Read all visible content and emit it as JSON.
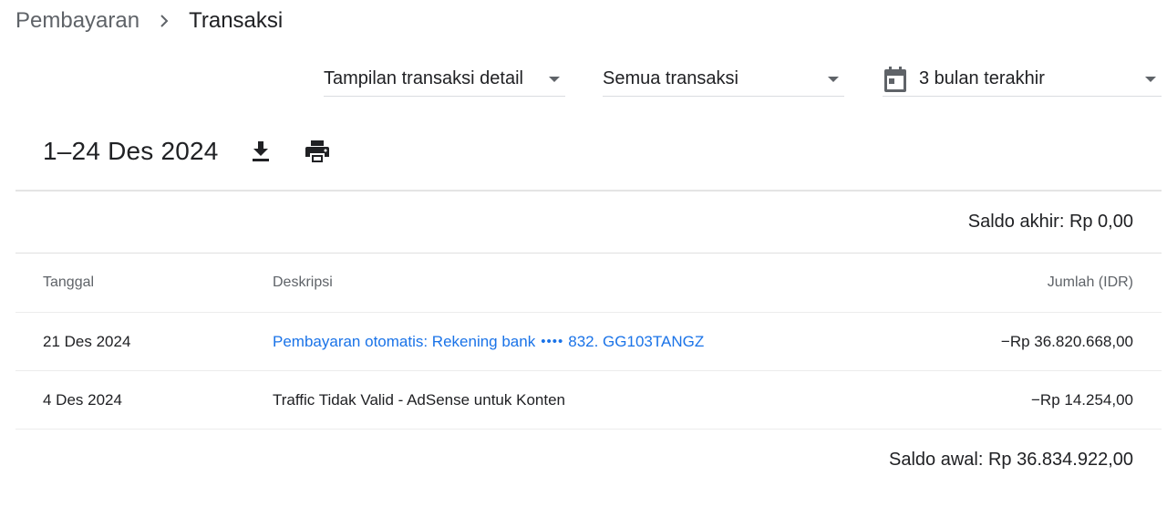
{
  "breadcrumb": {
    "parent": "Pembayaran",
    "current": "Transaksi"
  },
  "filters": {
    "view": "Tampilan transaksi detail",
    "type": "Semua transaksi",
    "range": "3 bulan terakhir"
  },
  "period": {
    "title": "1–24 Des 2024"
  },
  "end_balance": "Saldo akhir: Rp 0,00",
  "table": {
    "headers": {
      "date": "Tanggal",
      "description": "Deskripsi",
      "amount": "Jumlah (IDR)"
    },
    "rows": [
      {
        "date": "21 Des 2024",
        "description": "Pembayaran otomatis: Rekening bank",
        "masked_dots": "••••",
        "description_suffix": "832. GG103TANGZ",
        "amount": "−Rp 36.820.668,00"
      },
      {
        "date": "4 Des 2024",
        "description": "Traffic Tidak Valid - AdSense untuk Konten",
        "amount": "−Rp 14.254,00"
      }
    ]
  },
  "start_balance": "Saldo awal: Rp 36.834.922,00",
  "colors": {
    "link": "#1a73e8",
    "text": "#202124",
    "muted": "#5f6368"
  },
  "icons": {
    "breadcrumb_separator": "chevron-right-icon",
    "dropdown": "caret-down-icon",
    "range": "calendar-icon",
    "download": "download-icon",
    "print": "print-icon"
  }
}
